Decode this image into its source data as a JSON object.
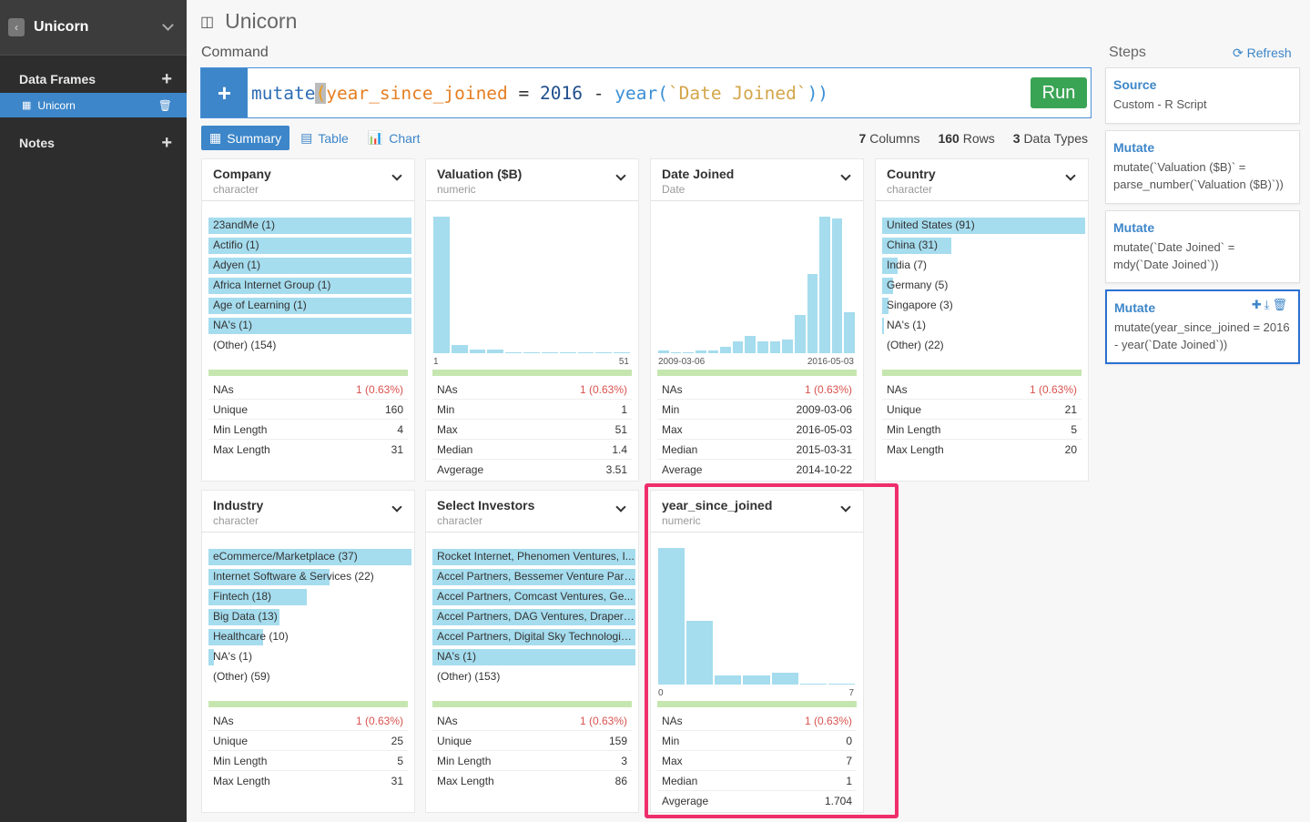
{
  "sidebar": {
    "project": "Unicorn",
    "data_frames_label": "Data Frames",
    "frames": [
      "Unicorn"
    ],
    "notes_label": "Notes"
  },
  "main": {
    "title": "Unicorn",
    "command_label": "Command",
    "command": {
      "fn": "mutate",
      "paren_open": "(",
      "col": "year_since_joined",
      "eq": " = ",
      "num": "2016",
      "minus": " - ",
      "year_fn": "year(",
      "arg": "`Date Joined`",
      "close": "))"
    },
    "run_label": "Run",
    "tabs": [
      {
        "label": "Summary",
        "active": true
      },
      {
        "label": "Table",
        "active": false
      },
      {
        "label": "Chart",
        "active": false
      }
    ],
    "stats": {
      "columns": "7",
      "columns_label": "Columns",
      "rows": "160",
      "rows_label": "Rows",
      "types": "3",
      "types_label": "Data Types"
    }
  },
  "cards": {
    "company": {
      "name": "Company",
      "type": "character",
      "cats": [
        {
          "label": "23andMe (1)",
          "frac": 1.0
        },
        {
          "label": "Actifio (1)",
          "frac": 1.0
        },
        {
          "label": "Adyen (1)",
          "frac": 1.0
        },
        {
          "label": "Africa Internet Group (1)",
          "frac": 1.0
        },
        {
          "label": "Age of Learning (1)",
          "frac": 1.0
        },
        {
          "label": "NA's (1)",
          "frac": 1.0
        },
        {
          "label": "(Other) (154)",
          "frac": 0
        }
      ],
      "stats": [
        [
          "NAs",
          "1 (0.63%)"
        ],
        [
          "Unique",
          "160"
        ],
        [
          "Min Length",
          "4"
        ],
        [
          "Max Length",
          "31"
        ]
      ]
    },
    "valuation": {
      "name": "Valuation ($B)",
      "type": "numeric",
      "hist": [
        1.0,
        0.06,
        0.025,
        0.025,
        0.01,
        0.008,
        0.008,
        0.008,
        0.008,
        0.006,
        0.006
      ],
      "axis": [
        "1",
        "51"
      ],
      "stats": [
        [
          "NAs",
          "1 (0.63%)"
        ],
        [
          "Min",
          "1"
        ],
        [
          "Max",
          "51"
        ],
        [
          "Median",
          "1.4"
        ],
        [
          "Avgerage",
          "3.51"
        ]
      ]
    },
    "date_joined": {
      "name": "Date Joined",
      "type": "Date",
      "hist": [
        0.02,
        0.01,
        0.01,
        0.02,
        0.02,
        0.05,
        0.09,
        0.13,
        0.09,
        0.09,
        0.1,
        0.28,
        0.58,
        1.0,
        0.99,
        0.3
      ],
      "axis": [
        "2009-03-06",
        "2016-05-03"
      ],
      "stats": [
        [
          "NAs",
          "1 (0.63%)"
        ],
        [
          "Min",
          "2009-03-06"
        ],
        [
          "Max",
          "2016-05-03"
        ],
        [
          "Median",
          "2015-03-31"
        ],
        [
          "Average",
          "2014-10-22"
        ]
      ]
    },
    "country": {
      "name": "Country",
      "type": "character",
      "cats": [
        {
          "label": "United States (91)",
          "frac": 1.0
        },
        {
          "label": "China (31)",
          "frac": 0.34
        },
        {
          "label": "India (7)",
          "frac": 0.077
        },
        {
          "label": "Germany (5)",
          "frac": 0.055
        },
        {
          "label": "Singapore (3)",
          "frac": 0.033
        },
        {
          "label": "NA's (1)",
          "frac": 0.011
        },
        {
          "label": "(Other) (22)",
          "frac": 0
        }
      ],
      "stats": [
        [
          "NAs",
          "1 (0.63%)"
        ],
        [
          "Unique",
          "21"
        ],
        [
          "Min Length",
          "5"
        ],
        [
          "Max Length",
          "20"
        ]
      ]
    },
    "industry": {
      "name": "Industry",
      "type": "character",
      "cats": [
        {
          "label": "eCommerce/Marketplace (37)",
          "frac": 1.0
        },
        {
          "label": "Internet Software & Services (22)",
          "frac": 0.595
        },
        {
          "label": "Fintech (18)",
          "frac": 0.486
        },
        {
          "label": "Big Data (13)",
          "frac": 0.351
        },
        {
          "label": "Healthcare (10)",
          "frac": 0.27
        },
        {
          "label": "NA's (1)",
          "frac": 0.027
        },
        {
          "label": "(Other) (59)",
          "frac": 0
        }
      ],
      "stats": [
        [
          "NAs",
          "1 (0.63%)"
        ],
        [
          "Unique",
          "25"
        ],
        [
          "Min Length",
          "5"
        ],
        [
          "Max Length",
          "31"
        ]
      ]
    },
    "investors": {
      "name": "Select Investors",
      "type": "character",
      "cats": [
        {
          "label": "Rocket Internet, Phenomen Ventures, I...",
          "frac": 1.0
        },
        {
          "label": "Accel Partners, Bessemer Venture Part...",
          "frac": 1.0
        },
        {
          "label": "Accel Partners, Comcast Ventures, Ge...",
          "frac": 1.0
        },
        {
          "label": "Accel Partners, DAG Ventures, Draper ...",
          "frac": 1.0
        },
        {
          "label": "Accel Partners, Digital Sky Technologie...",
          "frac": 1.0
        },
        {
          "label": "NA's (1)",
          "frac": 1.0
        },
        {
          "label": "(Other) (153)",
          "frac": 0
        }
      ],
      "stats": [
        [
          "NAs",
          "1 (0.63%)"
        ],
        [
          "Unique",
          "159"
        ],
        [
          "Min Length",
          "3"
        ],
        [
          "Max Length",
          "86"
        ]
      ]
    },
    "ysj": {
      "name": "year_since_joined",
      "type": "numeric",
      "hist": [
        1.0,
        0.47,
        0.07,
        0.07,
        0.09,
        0.006,
        0.006
      ],
      "axis": [
        "0",
        "7"
      ],
      "stats": [
        [
          "NAs",
          "1 (0.63%)"
        ],
        [
          "Min",
          "0"
        ],
        [
          "Max",
          "7"
        ],
        [
          "Median",
          "1"
        ],
        [
          "Avgerage",
          "1.704"
        ]
      ]
    }
  },
  "steps": {
    "label": "Steps",
    "refresh": "Refresh",
    "items": [
      {
        "title": "Source",
        "desc": "Custom - R Script",
        "active": false
      },
      {
        "title": "Mutate",
        "desc": "mutate(`Valuation ($B)` = parse_number(`Valuation ($B)`))",
        "active": false
      },
      {
        "title": "Mutate",
        "desc": "mutate(`Date Joined` = mdy(`Date Joined`))",
        "active": false
      },
      {
        "title": "Mutate",
        "desc": "mutate(year_since_joined = 2016 - year(`Date Joined`))",
        "active": true
      }
    ]
  },
  "colors": {
    "accent": "#3d86c9",
    "bar": "#a5dcee",
    "na": "#d9534f",
    "highlight": "#ef2f6b",
    "run": "#3aa455"
  }
}
